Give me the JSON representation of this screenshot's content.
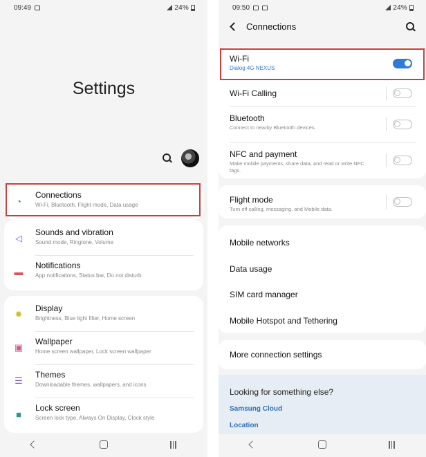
{
  "left": {
    "status": {
      "time": "09:49",
      "battery": "24%"
    },
    "title": "Settings",
    "groups": [
      [
        {
          "title": "Connections",
          "subtitle": "Wi-Fi, Bluetooth, Flight mode, Data usage",
          "icon": "wifi-icon",
          "color": "#3d7fd6"
        }
      ],
      [
        {
          "title": "Sounds and vibration",
          "subtitle": "Sound mode, Ringtone, Volume",
          "icon": "speaker-icon",
          "color": "#6b6bd6"
        },
        {
          "title": "Notifications",
          "subtitle": "App notifications, Status bar, Do not disturb",
          "icon": "notification-icon",
          "color": "#e0525b"
        }
      ],
      [
        {
          "title": "Display",
          "subtitle": "Brightness, Blue light filter, Home screen",
          "icon": "sun-icon",
          "color": "#c7c42a"
        },
        {
          "title": "Wallpaper",
          "subtitle": "Home screen wallpaper, Lock screen wallpaper",
          "icon": "wallpaper-icon",
          "color": "#d05b85"
        },
        {
          "title": "Themes",
          "subtitle": "Downloadable themes, wallpapers, and icons",
          "icon": "themes-icon",
          "color": "#8a55c6"
        },
        {
          "title": "Lock screen",
          "subtitle": "Screen lock type, Always On Display, Clock style",
          "icon": "lock-icon",
          "color": "#2a9a8a"
        }
      ]
    ]
  },
  "right": {
    "status": {
      "time": "09:50",
      "battery": "24%"
    },
    "header": {
      "title": "Connections"
    },
    "toggles": [
      {
        "title": "Wi-Fi",
        "subtitle": "Dialog 4G NEXUS",
        "on": true
      },
      {
        "title": "Wi-Fi Calling",
        "subtitle": "",
        "on": false
      },
      {
        "title": "Bluetooth",
        "subtitle": "Connect to nearby Bluetooth devices.",
        "on": false
      },
      {
        "title": "NFC and payment",
        "subtitle": "Make mobile payments, share data, and read or write NFC tags.",
        "on": false
      }
    ],
    "flight": {
      "title": "Flight mode",
      "subtitle": "Turn off calling, messaging, and Mobile data.",
      "on": false
    },
    "items": [
      "Mobile networks",
      "Data usage",
      "SIM card manager",
      "Mobile Hotspot and Tethering"
    ],
    "more": "More connection settings",
    "help": {
      "heading": "Looking for something else?",
      "links": [
        "Samsung Cloud",
        "Location"
      ]
    }
  },
  "colors": {
    "accent": "#2e7bd8",
    "highlight": "#d23a3a",
    "link": "#2f6fb5"
  }
}
